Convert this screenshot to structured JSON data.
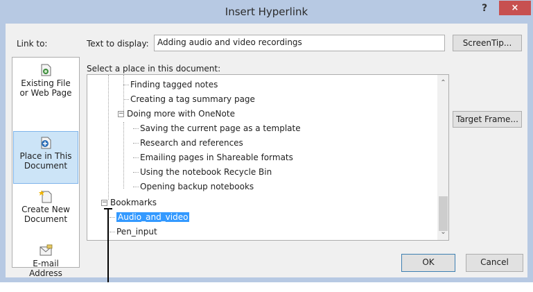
{
  "window": {
    "title": "Insert Hyperlink",
    "help_label": "?",
    "close_label": "×"
  },
  "link_to": {
    "label": "Link to:",
    "items": [
      {
        "line1": "Existing File",
        "line2": "or Web Page",
        "selected": false
      },
      {
        "line1": "Place in This",
        "line2": "Document",
        "selected": true
      },
      {
        "line1": "Create New",
        "line2": "Document",
        "selected": false
      },
      {
        "line1": "E-mail",
        "line2": "Address",
        "selected": false
      }
    ]
  },
  "text_to_display": {
    "label": "Text to display:",
    "value": "Adding audio and video recordings"
  },
  "buttons": {
    "screentip": "ScreenTip...",
    "target_frame": "Target Frame...",
    "ok": "OK",
    "cancel": "Cancel"
  },
  "tree": {
    "label": "Select a place in this document:",
    "rows": [
      {
        "text": "Finding tagged notes",
        "level": 2
      },
      {
        "text": "Creating a tag summary page",
        "level": 2
      },
      {
        "text": "Doing more with OneNote",
        "level": 1,
        "expander": "−"
      },
      {
        "text": "Saving the current page as a template",
        "level": 2
      },
      {
        "text": "Research and references",
        "level": 2
      },
      {
        "text": "Emailing pages in Shareable formats",
        "level": 2
      },
      {
        "text": "Using the notebook Recycle Bin",
        "level": 2
      },
      {
        "text": "Opening backup notebooks",
        "level": 2
      },
      {
        "text": "Bookmarks",
        "level": 0,
        "expander": "−"
      },
      {
        "text": "Audio_and_video",
        "level": 1,
        "selected": true
      },
      {
        "text": "Pen_input",
        "level": 1
      }
    ]
  }
}
